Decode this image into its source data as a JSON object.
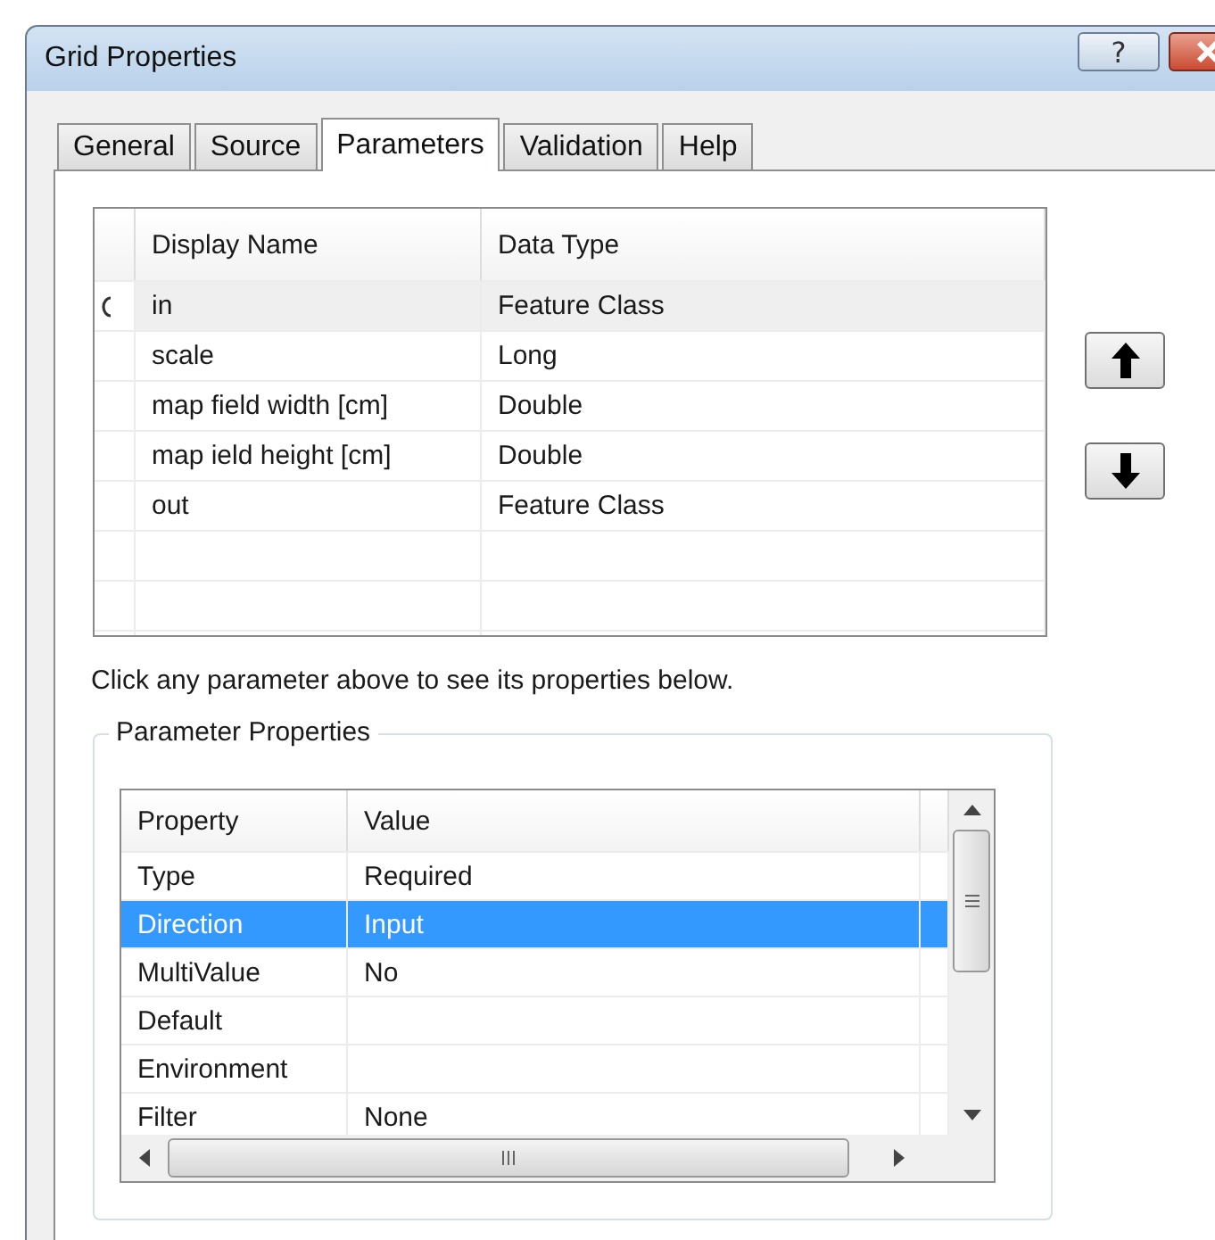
{
  "window": {
    "title": "Grid Properties",
    "help_label": "?"
  },
  "tabs": [
    {
      "label": "General",
      "selected": false
    },
    {
      "label": "Source",
      "selected": false
    },
    {
      "label": "Parameters",
      "selected": true
    },
    {
      "label": "Validation",
      "selected": false
    },
    {
      "label": "Help",
      "selected": false
    }
  ],
  "parameters_table": {
    "columns": [
      "Display Name",
      "Data Type"
    ],
    "rows": [
      {
        "name": "in",
        "type": "Feature Class",
        "selected": true
      },
      {
        "name": "scale",
        "type": "Long",
        "selected": false
      },
      {
        "name": "map field width [cm]",
        "type": "Double",
        "selected": false
      },
      {
        "name": "map ield height [cm]",
        "type": "Double",
        "selected": false
      },
      {
        "name": "out",
        "type": "Feature Class",
        "selected": false
      }
    ]
  },
  "hint": "Click any parameter above to see its properties below.",
  "parameter_properties": {
    "legend": "Parameter Properties",
    "columns": [
      "Property",
      "Value"
    ],
    "rows": [
      {
        "property": "Type",
        "value": "Required",
        "selected": false
      },
      {
        "property": "Direction",
        "value": "Input",
        "selected": true
      },
      {
        "property": "MultiValue",
        "value": "No",
        "selected": false
      },
      {
        "property": "Default",
        "selected": false
      },
      {
        "property": "Environment",
        "selected": false
      },
      {
        "property": "Filter",
        "value": "None",
        "selected": false
      }
    ]
  }
}
